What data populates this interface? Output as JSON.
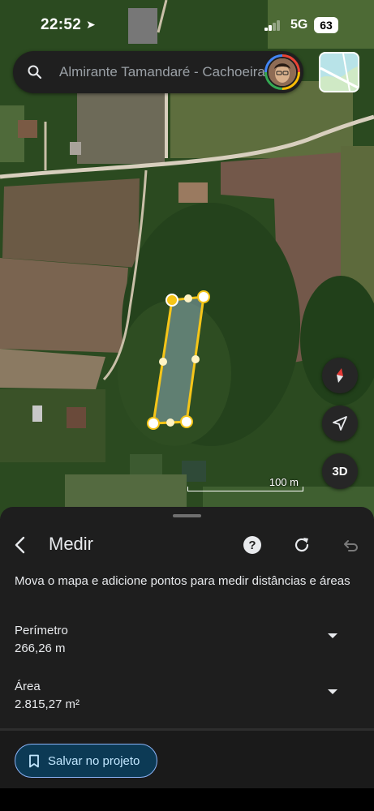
{
  "status_bar": {
    "time": "22:52",
    "network": "5G",
    "battery": "63"
  },
  "search": {
    "placeholder": "Almirante Tamandaré - Cachoeira"
  },
  "map": {
    "scale_label": "100 m",
    "btn_3d_label": "3D"
  },
  "panel": {
    "title": "Medir",
    "help_label": "?",
    "instructions": "Mova o mapa e adicione pontos para medir distâncias e áreas",
    "perimeter": {
      "label": "Perímetro",
      "value": "266,26 m"
    },
    "area": {
      "label": "Área",
      "value": "2.815,27 m²"
    },
    "save_label": "Salvar no projeto"
  },
  "colors": {
    "measure_line": "#f5c518",
    "measure_fill": "#8aa9b5",
    "panel_bg": "#1e1e1e",
    "save_border": "#8ab4f8",
    "compass_red": "#e53935"
  }
}
